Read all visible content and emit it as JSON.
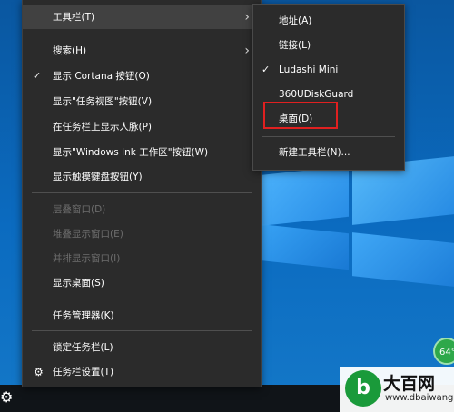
{
  "main_menu": {
    "items": [
      {
        "label": "工具栏(T)",
        "submenu": true,
        "highlighted": true
      },
      {
        "label": "搜索(H)",
        "submenu": true
      },
      {
        "label": "显示 Cortana 按钮(O)",
        "checked": true
      },
      {
        "label": "显示\"任务视图\"按钮(V)"
      },
      {
        "label": "在任务栏上显示人脉(P)"
      },
      {
        "label": "显示\"Windows Ink 工作区\"按钮(W)"
      },
      {
        "label": "显示触摸键盘按钮(Y)"
      },
      {
        "label": "层叠窗口(D)",
        "disabled": true
      },
      {
        "label": "堆叠显示窗口(E)",
        "disabled": true
      },
      {
        "label": "并排显示窗口(I)",
        "disabled": true
      },
      {
        "label": "显示桌面(S)"
      },
      {
        "label": "任务管理器(K)"
      },
      {
        "label": "锁定任务栏(L)"
      },
      {
        "label": "任务栏设置(T)"
      }
    ],
    "check_symbol": "✓",
    "arrow_symbol": "›",
    "settings_icon": "gear-icon"
  },
  "toolbar_submenu": {
    "items": [
      {
        "label": "地址(A)"
      },
      {
        "label": "链接(L)"
      },
      {
        "label": "Ludashi Mini",
        "checked": true
      },
      {
        "label": "360UDiskGuard"
      },
      {
        "label": "桌面(D)",
        "annotated": true
      },
      {
        "label": "新建工具栏(N)..."
      }
    ],
    "annotation_color": "#e02020"
  },
  "taskbar": {
    "gear_icon": "gear-icon"
  },
  "tray_badge": {
    "text": "64°"
  },
  "watermark": {
    "title": "大百网",
    "url": "www.dbaiwang.com",
    "logo_glyph": "b"
  },
  "colors": {
    "menu_bg": "#2b2b2b",
    "highlight": "#414141",
    "disabled_text": "#6d6d6d"
  }
}
